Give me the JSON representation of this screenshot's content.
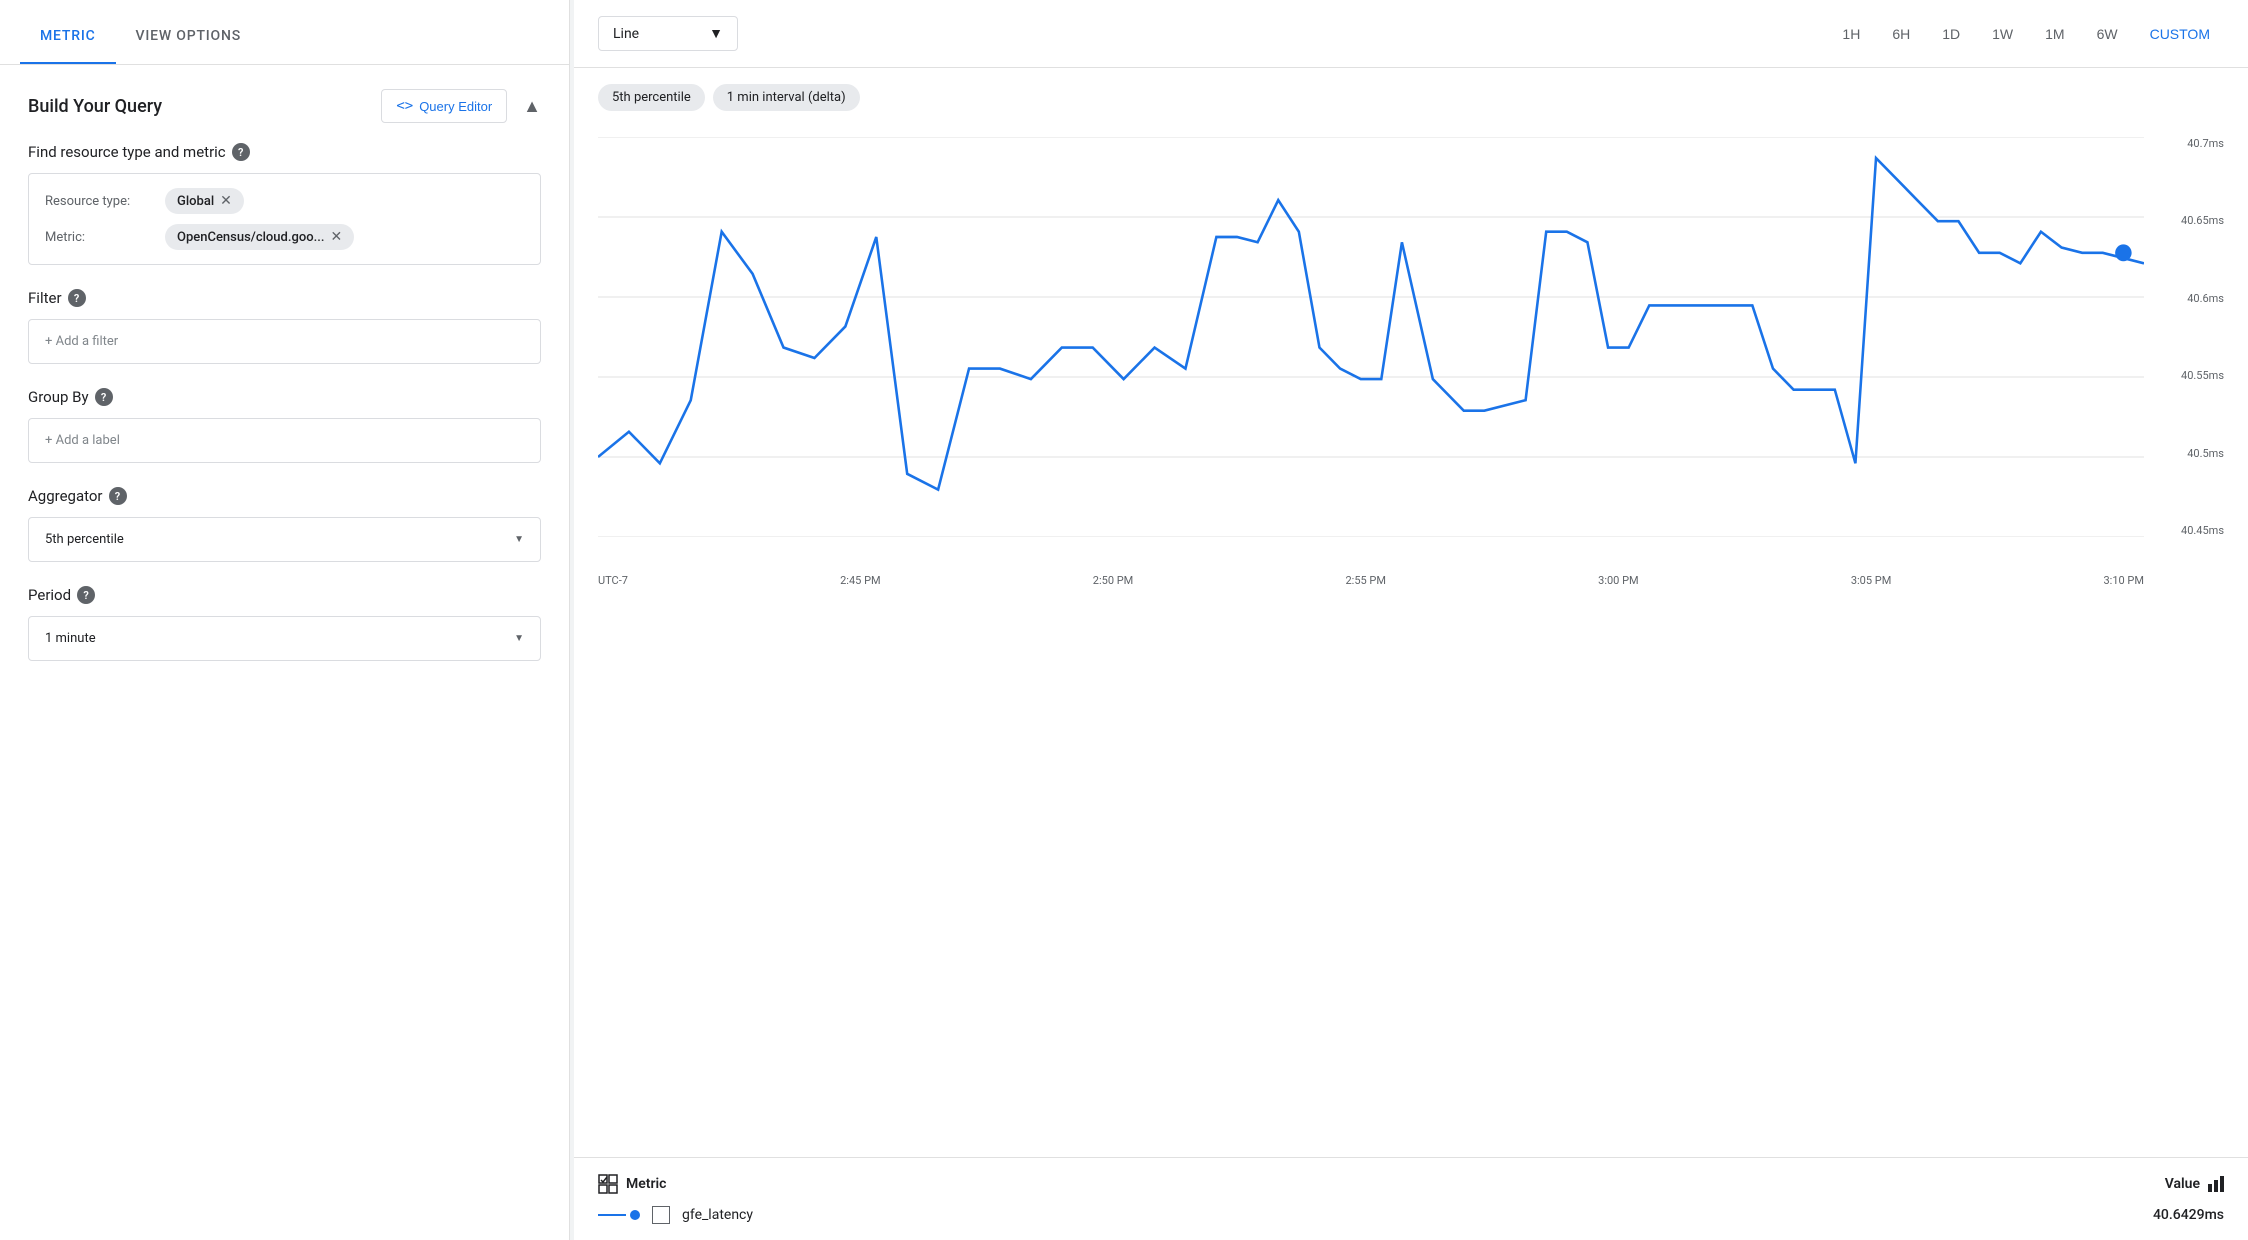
{
  "tabs": {
    "metric": "METRIC",
    "viewOptions": "VIEW OPTIONS"
  },
  "querySection": {
    "title": "Build Your Query",
    "editorBtn": "Query Editor",
    "collapseIcon": "▲"
  },
  "findResource": {
    "label": "Find resource type and metric",
    "resourceTypeLabel": "Resource type:",
    "resourceTypeValue": "Global",
    "metricLabel": "Metric:",
    "metricValue": "OpenCensus/cloud.goo..."
  },
  "filter": {
    "label": "Filter",
    "placeholder": "+ Add a filter"
  },
  "groupBy": {
    "label": "Group By",
    "placeholder": "+ Add a label"
  },
  "aggregator": {
    "label": "Aggregator",
    "value": "5th percentile"
  },
  "period": {
    "label": "Period",
    "value": "1 minute"
  },
  "chartToolbar": {
    "chartType": "Line",
    "timeButtons": [
      "1H",
      "6H",
      "1D",
      "1W",
      "1M",
      "6W",
      "CUSTOM"
    ],
    "activeTime": "CUSTOM"
  },
  "chartPills": [
    "5th percentile",
    "1 min interval (delta)"
  ],
  "yAxis": {
    "labels": [
      "40.7ms",
      "40.65ms",
      "40.6ms",
      "40.55ms",
      "40.5ms",
      "40.45ms"
    ]
  },
  "xAxis": {
    "labels": [
      "UTC-7",
      "2:45 PM",
      "2:50 PM",
      "2:55 PM",
      "3:00 PM",
      "3:05 PM",
      "3:10 PM"
    ]
  },
  "legend": {
    "metricHeader": "Metric",
    "valueHeader": "Value",
    "rows": [
      {
        "name": "gfe_latency",
        "value": "40.6429ms"
      }
    ]
  }
}
